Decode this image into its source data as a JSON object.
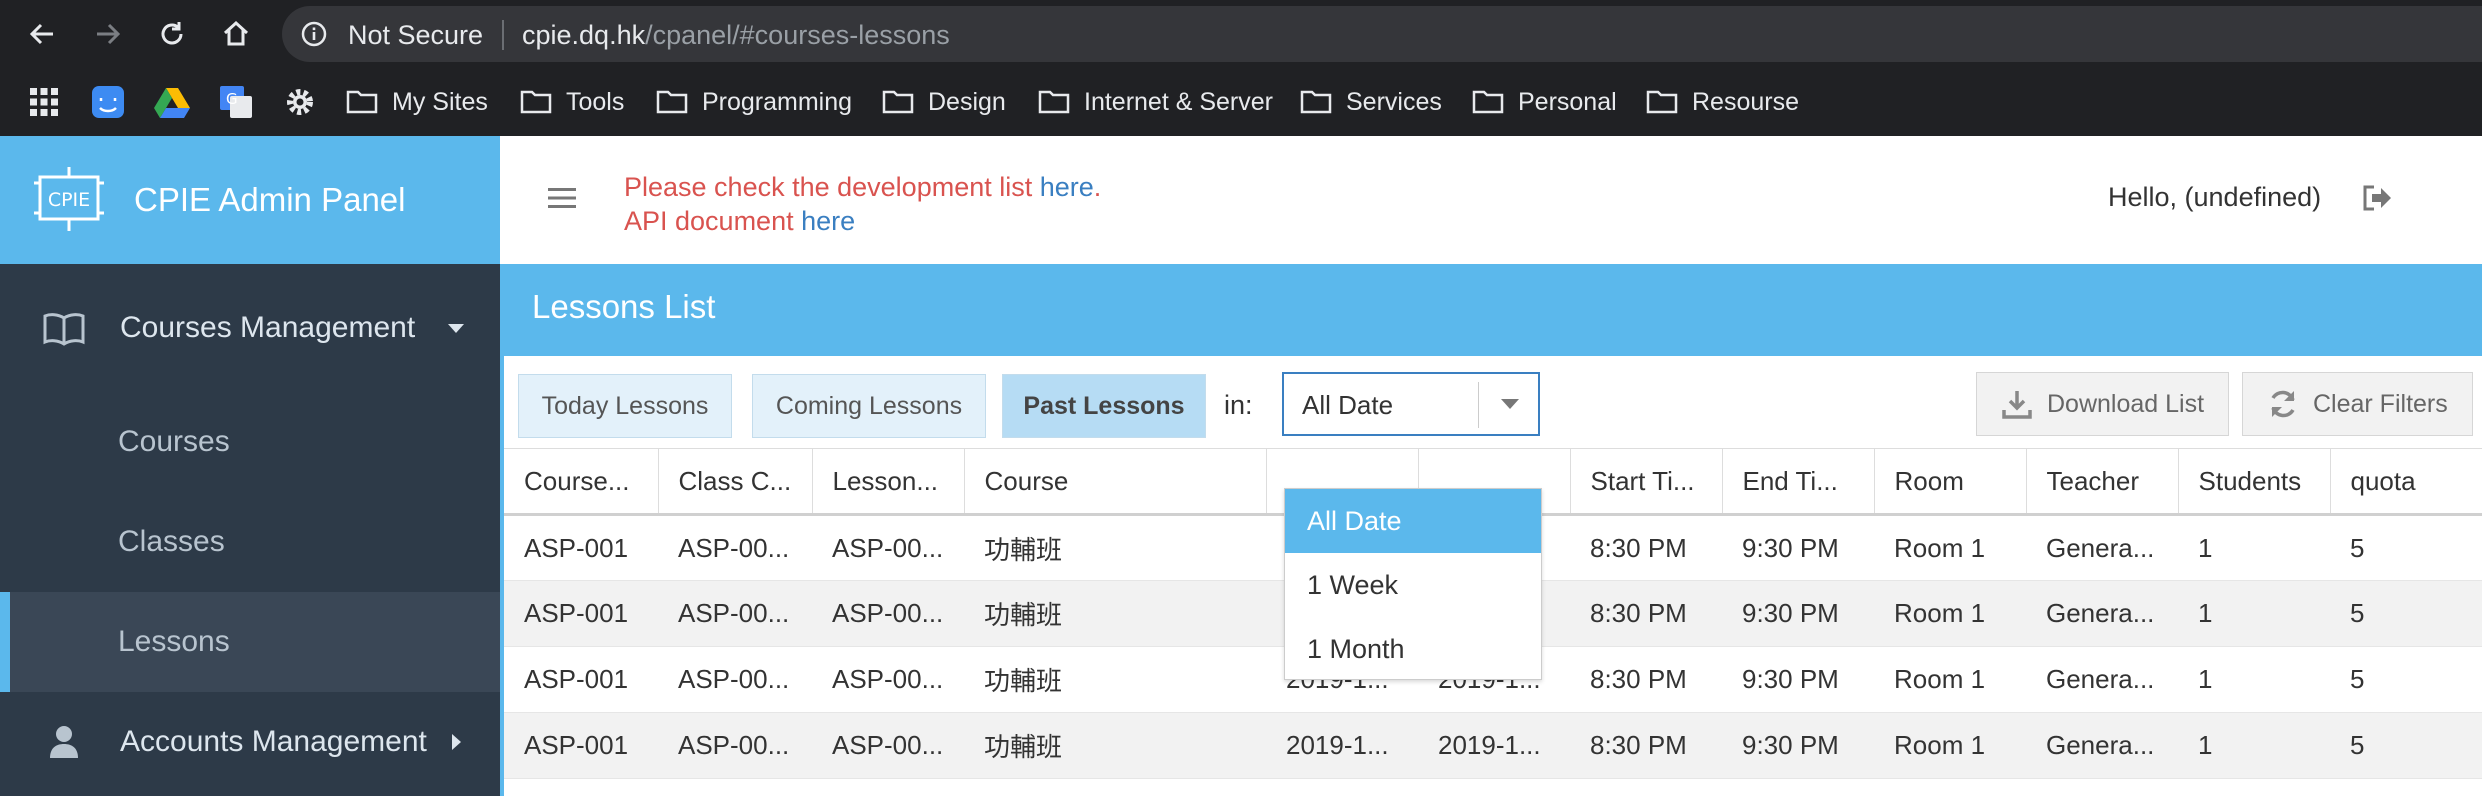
{
  "browser": {
    "security": "Not Secure",
    "url_host": "cpie.dq.hk",
    "url_path": "/cpanel/#courses-lessons",
    "bookmarks": [
      "My Sites",
      "Tools",
      "Programming",
      "Design",
      "Internet & Server",
      "Services",
      "Personal",
      "Resourse"
    ]
  },
  "brand": {
    "logo_text": "CPIE",
    "name": "CPIE Admin Panel"
  },
  "sidebar": {
    "courses_management": "Courses Management",
    "items": [
      "Courses",
      "Classes",
      "Lessons"
    ],
    "active_item": "Lessons",
    "accounts_management": "Accounts Management"
  },
  "topbar": {
    "notice_line1": "Please check the development list ",
    "notice_link1": "here",
    "notice_period": ".",
    "notice_line2": "API document ",
    "notice_link2": "here",
    "greeting": "Hello, (undefined)"
  },
  "content": {
    "title": "Lessons List",
    "filters": {
      "today": "Today Lessons",
      "coming": "Coming Lessons",
      "past": "Past Lessons",
      "in_label": "in:",
      "date_select": "All Date",
      "date_options": [
        "All Date",
        "1 Week",
        "1 Month"
      ],
      "download": "Download List",
      "clear": "Clear Filters"
    },
    "columns": [
      "Course...",
      "Class C...",
      "Lesson...",
      "Course",
      "",
      "",
      "Start Ti...",
      "End Ti...",
      "Room",
      "Teacher",
      "Students",
      "quota"
    ],
    "rows": [
      [
        "ASP-001",
        "ASP-00...",
        "ASP-00...",
        "功輔班",
        "",
        "",
        "8:30 PM",
        "9:30 PM",
        "Room 1",
        "Genera...",
        "1",
        "5"
      ],
      [
        "ASP-001",
        "ASP-00...",
        "ASP-00...",
        "功輔班",
        "",
        "",
        "8:30 PM",
        "9:30 PM",
        "Room 1",
        "Genera...",
        "1",
        "5"
      ],
      [
        "ASP-001",
        "ASP-00...",
        "ASP-00...",
        "功輔班",
        "2019-1...",
        "2019-1...",
        "8:30 PM",
        "9:30 PM",
        "Room 1",
        "Genera...",
        "1",
        "5"
      ],
      [
        "ASP-001",
        "ASP-00...",
        "ASP-00...",
        "功輔班",
        "2019-1...",
        "2019-1...",
        "8:30 PM",
        "9:30 PM",
        "Room 1",
        "Genera...",
        "1",
        "5"
      ]
    ]
  },
  "colors": {
    "accent": "#5bb8ec",
    "sidebar": "#2d3a48",
    "notice": "#d9534f",
    "link": "#3a7fc1"
  },
  "icons": [
    "back-icon",
    "forward-icon",
    "reload-icon",
    "home-icon",
    "info-icon",
    "apps-icon",
    "finder-icon",
    "drive-icon",
    "translate-icon",
    "settings-icon",
    "folder-icon",
    "book-icon",
    "user-icon",
    "menu-icon",
    "logout-icon",
    "download-icon",
    "refresh-icon"
  ]
}
